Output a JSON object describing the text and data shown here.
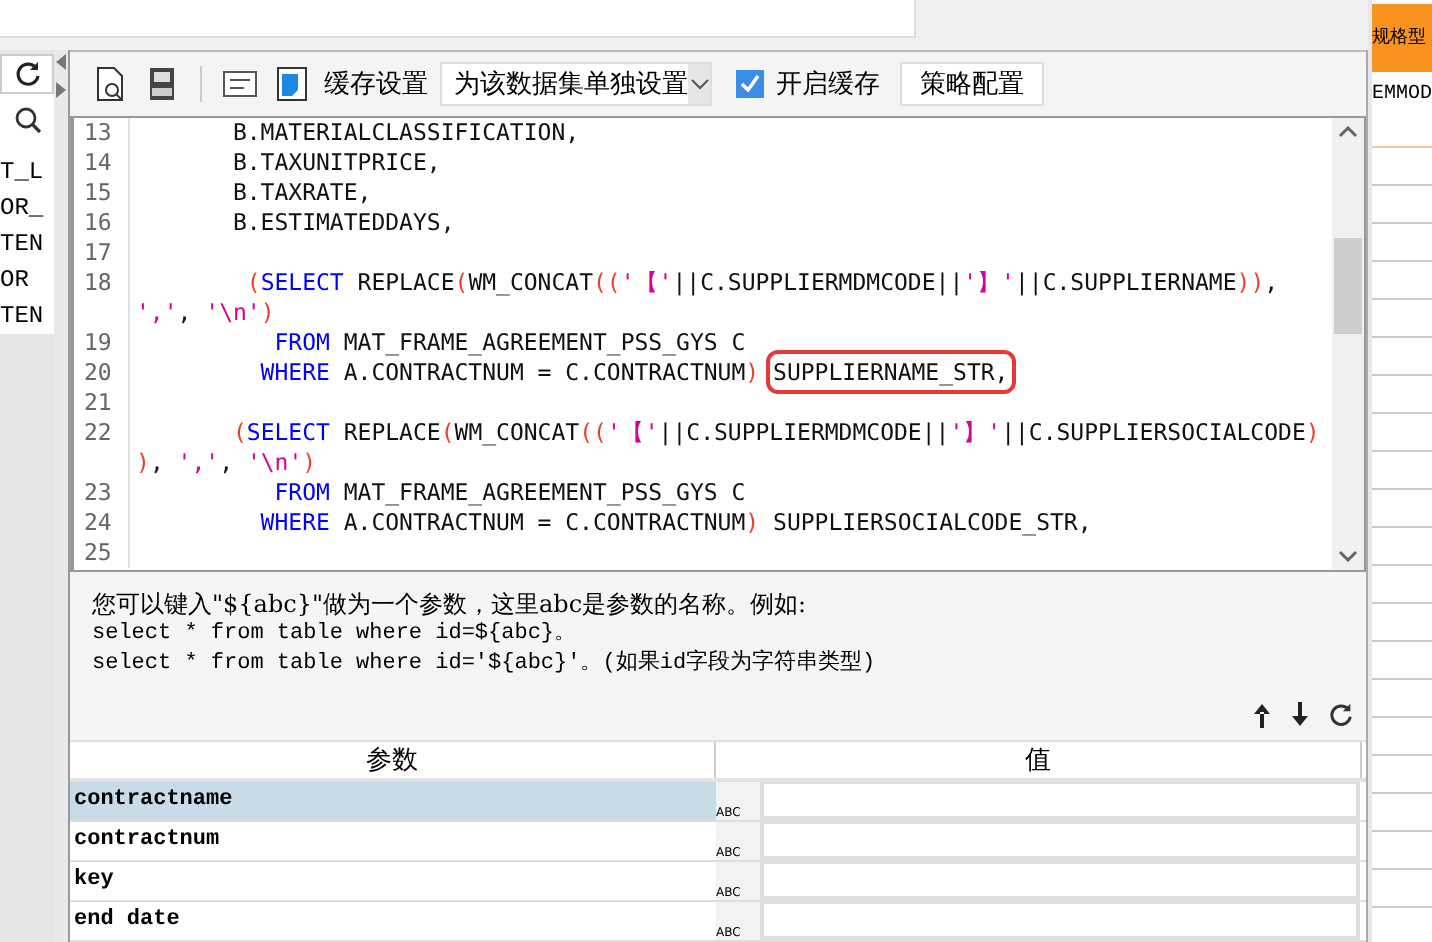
{
  "sidebar": {
    "items": [
      {
        "label": "T_L"
      },
      {
        "label": "OR_"
      },
      {
        "label": "TEN"
      },
      {
        "label": "OR"
      },
      {
        "label": "TEN"
      }
    ]
  },
  "toolbar": {
    "cache_label": "缓存设置",
    "cache_mode": "为该数据集单独设置",
    "cache_enabled": {
      "label": "开启缓存",
      "checked": true
    },
    "strategy_button": "策略配置"
  },
  "editor": {
    "lines": [
      {
        "number": "13",
        "segments": [
          {
            "kind": "plain",
            "text": "       B.MATERIALCLASSIFICATION,"
          }
        ]
      },
      {
        "number": "14",
        "segments": [
          {
            "kind": "plain",
            "text": "       B.TAXUNITPRICE,"
          }
        ]
      },
      {
        "number": "15",
        "segments": [
          {
            "kind": "plain",
            "text": "       B.TAXRATE,"
          }
        ]
      },
      {
        "number": "16",
        "segments": [
          {
            "kind": "plain",
            "text": "       B.ESTIMATEDDAYS,"
          }
        ]
      },
      {
        "number": "17"
      },
      {
        "number": "18",
        "segments": [
          {
            "kind": "paren",
            "text": "        ("
          },
          {
            "kind": "kw",
            "text": "SELECT"
          },
          {
            "kind": "plain",
            "text": " REPLACE"
          },
          {
            "kind": "paren",
            "text": "("
          },
          {
            "kind": "plain",
            "text": "WM_CONCAT"
          },
          {
            "kind": "paren",
            "text": "(("
          },
          {
            "kind": "str",
            "text": "'【'"
          },
          {
            "kind": "plain",
            "text": "||C.SUPPLIERMDMCODE||"
          },
          {
            "kind": "str",
            "text": "'】'"
          },
          {
            "kind": "plain",
            "text": "||C.SUPPLIERNAME"
          },
          {
            "kind": "paren",
            "text": "))"
          },
          {
            "kind": "plain",
            "text": ","
          }
        ]
      },
      {
        "segments": [
          {
            "kind": "str",
            "text": "','"
          },
          {
            "kind": "plain",
            "text": ", "
          },
          {
            "kind": "str",
            "text": "'\\n'"
          },
          {
            "kind": "paren",
            "text": ")"
          }
        ]
      },
      {
        "number": "19",
        "segments": [
          {
            "kind": "kw",
            "text": "          FROM"
          },
          {
            "kind": "plain",
            "text": " MAT_FRAME_AGREEMENT_PSS_GYS C"
          }
        ]
      },
      {
        "number": "20",
        "segments": [
          {
            "kind": "kw",
            "text": "         WHERE"
          },
          {
            "kind": "plain",
            "text": " A.CONTRACTNUM = C.CONTRACTNUM"
          },
          {
            "kind": "paren",
            "text": ") "
          },
          {
            "kind": "marked",
            "text": "SUPPLIERNAME_STR,"
          }
        ]
      },
      {
        "number": "21"
      },
      {
        "number": "22",
        "segments": [
          {
            "kind": "paren",
            "text": "       ("
          },
          {
            "kind": "kw",
            "text": "SELECT"
          },
          {
            "kind": "plain",
            "text": " REPLACE"
          },
          {
            "kind": "paren",
            "text": "("
          },
          {
            "kind": "plain",
            "text": "WM_CONCAT"
          },
          {
            "kind": "paren",
            "text": "(("
          },
          {
            "kind": "str",
            "text": "'【'"
          },
          {
            "kind": "plain",
            "text": "||C.SUPPLIERMDMCODE||"
          },
          {
            "kind": "str",
            "text": "'】'"
          },
          {
            "kind": "plain",
            "text": "||C.SUPPLIERSOCIALCODE"
          },
          {
            "kind": "paren",
            "text": ")"
          }
        ]
      },
      {
        "segments": [
          {
            "kind": "paren",
            "text": ")"
          },
          {
            "kind": "plain",
            "text": ", "
          },
          {
            "kind": "str",
            "text": "','"
          },
          {
            "kind": "plain",
            "text": ", "
          },
          {
            "kind": "str",
            "text": "'\\n'"
          },
          {
            "kind": "paren",
            "text": ")"
          }
        ]
      },
      {
        "number": "23",
        "segments": [
          {
            "kind": "kw",
            "text": "          FROM"
          },
          {
            "kind": "plain",
            "text": " MAT_FRAME_AGREEMENT_PSS_GYS C"
          }
        ]
      },
      {
        "number": "24",
        "segments": [
          {
            "kind": "kw",
            "text": "         WHERE"
          },
          {
            "kind": "plain",
            "text": " A.CONTRACTNUM = C.CONTRACTNUM"
          },
          {
            "kind": "paren",
            "text": ")"
          },
          {
            "kind": "plain",
            "text": " SUPPLIERSOCIALCODE_STR,"
          }
        ]
      },
      {
        "number": "25"
      }
    ]
  },
  "help": {
    "intro": "您可以键入\"${abc}\"做为一个参数，这里abc是参数的名称。例如:",
    "examples": [
      "select * from table where id=${abc}。",
      "select * from table where id='${abc}'。(如果id字段为字符串类型)"
    ]
  },
  "parameters": {
    "columns": [
      "参数",
      "值"
    ],
    "rows": [
      {
        "name": "contractname",
        "type_label": "ABC",
        "selected": true
      },
      {
        "name": "contractnum",
        "type_label": "ABC",
        "selected": false
      },
      {
        "name": "key",
        "type_label": "ABC",
        "selected": false
      },
      {
        "name": "end date",
        "type_label": "ABC",
        "selected": false
      }
    ]
  },
  "right_panel": {
    "header": "规格型",
    "cell": "EMMOD"
  }
}
